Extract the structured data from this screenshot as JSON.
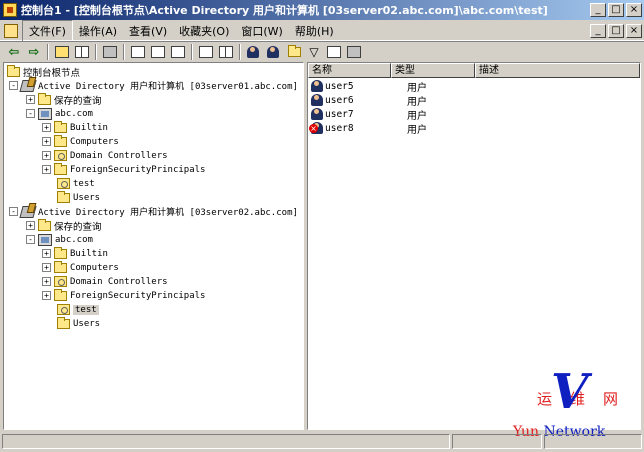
{
  "window": {
    "title": "控制台1 - [控制台根节点\\Active Directory 用户和计算机 [03server02.abc.com]\\abc.com\\test]",
    "min_glyph": "_",
    "max_glyph": "□",
    "close_glyph": "×"
  },
  "menubar": {
    "items": [
      "文件(F)",
      "操作(A)",
      "查看(V)",
      "收藏夹(O)",
      "窗口(W)",
      "帮助(H)"
    ],
    "child_min": "_",
    "child_restore": "□",
    "child_close": "×"
  },
  "toolbar": {
    "back": "⇦",
    "forward": "⇨"
  },
  "tree": {
    "root": "控制台根节点",
    "ad1": "Active Directory 用户和计算机 [03server01.abc.com]",
    "ad2": "Active Directory 用户和计算机 [03server02.abc.com]",
    "saved_queries": "保存的查询",
    "domain": "abc.com",
    "builtin": "Builtin",
    "computers": "Computers",
    "dcs": "Domain Controllers",
    "fsp": "ForeignSecurityPrincipals",
    "test": "test",
    "users": "Users",
    "plus": "+",
    "minus": "-"
  },
  "list": {
    "columns": [
      "名称",
      "类型",
      "描述"
    ],
    "rows": [
      {
        "name": "user5",
        "type": "用户",
        "icon": "user-icon",
        "disabled": false
      },
      {
        "name": "user6",
        "type": "用户",
        "icon": "user-icon",
        "disabled": false
      },
      {
        "name": "user7",
        "type": "用户",
        "icon": "user-icon",
        "disabled": false
      },
      {
        "name": "user8",
        "type": "用户",
        "icon": "disabled-user-icon",
        "disabled": true
      }
    ]
  },
  "watermark": {
    "top": "运维网",
    "v": "V",
    "yun": "Yun",
    "network": "Network"
  },
  "colors": {
    "titlebar_start": "#0a246a",
    "titlebar_end": "#a6caf0",
    "face": "#d4d0c8",
    "watermark_red": "#e02020",
    "watermark_blue": "#1020c0"
  }
}
